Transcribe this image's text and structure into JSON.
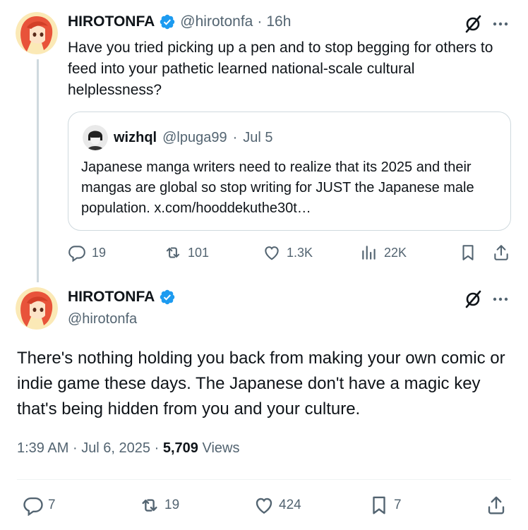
{
  "tweet1": {
    "author_name": "HIROTONFA",
    "handle": "@hirotonfa",
    "separator": "·",
    "time": "16h",
    "text": "Have you tried picking up a pen and to stop begging for others to feed into your pathetic learned national-scale cultural helplessness?",
    "quote": {
      "author_name": "wizhql",
      "handle": "@lpuga99",
      "separator": "·",
      "date": "Jul 5",
      "text": "Japanese manga writers need to realize that its 2025 and their mangas are global so stop writing for JUST the Japanese male population. x.com/hooddekuthe30t…"
    },
    "actions": {
      "replies": "19",
      "reposts": "101",
      "likes": "1.3K",
      "views": "22K"
    }
  },
  "tweet2": {
    "author_name": "HIROTONFA",
    "handle": "@hirotonfa",
    "text": "There's nothing holding you back from making your own comic or indie game these days. The Japanese don't have a magic key that's being hidden from you and your culture.",
    "time": "1:39 AM",
    "date": "Jul 6, 2025",
    "separator": "·",
    "views_count": "5,709",
    "views_label": "Views",
    "actions": {
      "replies": "7",
      "reposts": "19",
      "likes": "424",
      "bookmarks": "7"
    }
  },
  "icons": {
    "verified": "verified-badge-icon",
    "grok": "grok-icon",
    "more": "more-icon",
    "reply": "reply-icon",
    "repost": "repost-icon",
    "like": "like-icon",
    "views": "views-icon",
    "bookmark": "bookmark-icon",
    "share": "share-icon"
  },
  "colors": {
    "text": "#0f1419",
    "muted": "#536471",
    "verified": "#1d9bf0",
    "border": "#cfd9de",
    "avatar_hair": "#e8533a",
    "avatar_bg": "#fbe9b6"
  }
}
